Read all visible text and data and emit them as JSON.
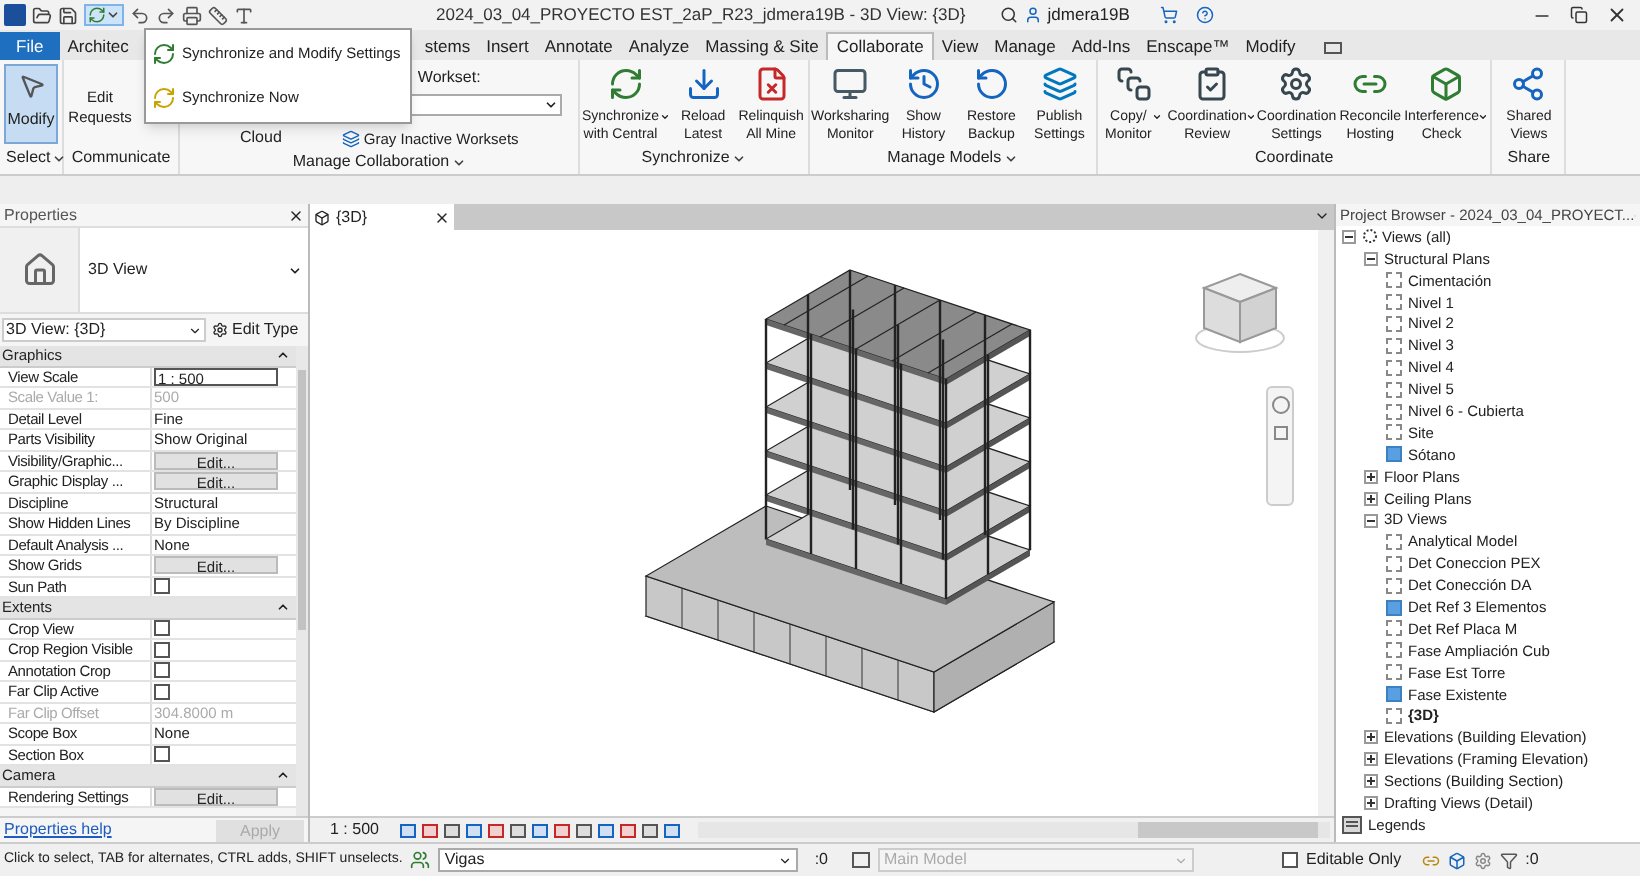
{
  "title_bar": {
    "title": "2024_03_04_PROYECTO EST_2aP_R23_jdmera19B - 3D View: {3D}",
    "user": "jdmera19B"
  },
  "sync_menu": [
    {
      "label": "Synchronize and Modify Settings"
    },
    {
      "label": "Synchronize Now"
    }
  ],
  "tabs": [
    {
      "label": "File",
      "kind": "file",
      "selected": false
    },
    {
      "label": "Architec",
      "kind": "tab",
      "selected": false
    },
    {
      "label": "stems",
      "kind": "tab",
      "selected": false
    },
    {
      "label": "Insert",
      "kind": "tab",
      "selected": false
    },
    {
      "label": "Annotate",
      "kind": "tab",
      "selected": false
    },
    {
      "label": "Analyze",
      "kind": "tab",
      "selected": false
    },
    {
      "label": "Massing & Site",
      "kind": "tab",
      "selected": false
    },
    {
      "label": "Collaborate",
      "kind": "tab",
      "selected": true
    },
    {
      "label": "View",
      "kind": "tab",
      "selected": false
    },
    {
      "label": "Manage",
      "kind": "tab",
      "selected": false
    },
    {
      "label": "Add-Ins",
      "kind": "tab",
      "selected": false
    },
    {
      "label": "Enscape™",
      "kind": "tab",
      "selected": false
    },
    {
      "label": "Modify",
      "kind": "tab",
      "selected": false
    }
  ],
  "ribbon": {
    "select": {
      "button": {
        "label": "Modify",
        "selected": true
      },
      "label": "Select"
    },
    "communicate": {
      "button": {
        "label": "Edit Requests"
      },
      "label": "Communicate"
    },
    "manage_collaboration": {
      "cloud": "Cloud",
      "workset_label": "Workset:",
      "gray_inactive": "Gray Inactive Worksets",
      "label": "Manage Collaboration"
    },
    "panels": [
      {
        "label": "Synchronize",
        "buttons": [
          {
            "label": "Synchronize with Central",
            "split": true
          },
          {
            "label": "Reload Latest",
            "split": false
          },
          {
            "label": "Relinquish All Mine",
            "split": false
          }
        ]
      },
      {
        "label": "Manage Models",
        "buttons": [
          {
            "label": "Worksharing Monitor",
            "split": false
          },
          {
            "label": "Show History",
            "split": false
          },
          {
            "label": "Restore Backup",
            "split": false
          },
          {
            "label": "Publish Settings",
            "split": false
          }
        ]
      },
      {
        "label": "Coordinate",
        "buttons": [
          {
            "label": "Copy/ Monitor",
            "split": true
          },
          {
            "label": "Coordination Review",
            "split": true
          },
          {
            "label": "Coordination Settings",
            "split": false
          },
          {
            "label": "Reconcile Hosting",
            "split": false
          },
          {
            "label": "Interference Check",
            "split": true
          }
        ]
      },
      {
        "label": "Share",
        "buttons": [
          {
            "label": "Shared Views",
            "split": false
          }
        ]
      }
    ]
  },
  "properties": {
    "title": "Properties",
    "type_name": "3D View",
    "instance": "3D View: {3D}",
    "edit_type": "Edit Type",
    "rows": [
      {
        "kind": "group",
        "label": "Graphics"
      },
      {
        "kind": "input",
        "label": "View Scale",
        "value": "1 : 500",
        "disabled": false
      },
      {
        "kind": "text",
        "label": "Scale Value 1:",
        "value": "500",
        "disabled": true
      },
      {
        "kind": "text",
        "label": "Detail Level",
        "value": "Fine",
        "disabled": false
      },
      {
        "kind": "text",
        "label": "Parts Visibility",
        "value": "Show Original",
        "disabled": false
      },
      {
        "kind": "button",
        "label": "Visibility/Graphic...",
        "value": "Edit...",
        "disabled": false
      },
      {
        "kind": "button",
        "label": "Graphic Display ...",
        "value": "Edit...",
        "disabled": false
      },
      {
        "kind": "text",
        "label": "Discipline",
        "value": "Structural",
        "disabled": false
      },
      {
        "kind": "text",
        "label": "Show Hidden Lines",
        "value": "By Discipline",
        "disabled": false
      },
      {
        "kind": "text",
        "label": "Default Analysis ...",
        "value": "None",
        "disabled": false
      },
      {
        "kind": "button",
        "label": "Show Grids",
        "value": "Edit...",
        "disabled": false
      },
      {
        "kind": "checkbox",
        "label": "Sun Path",
        "checked": false,
        "disabled": false
      },
      {
        "kind": "group",
        "label": "Extents"
      },
      {
        "kind": "checkbox",
        "label": "Crop View",
        "checked": false,
        "disabled": false
      },
      {
        "kind": "checkbox",
        "label": "Crop Region Visible",
        "checked": false,
        "disabled": false
      },
      {
        "kind": "checkbox",
        "label": "Annotation Crop",
        "checked": false,
        "disabled": false
      },
      {
        "kind": "checkbox",
        "label": "Far Clip Active",
        "checked": false,
        "disabled": false
      },
      {
        "kind": "text",
        "label": "Far Clip Offset",
        "value": "304.8000 m",
        "disabled": true
      },
      {
        "kind": "text",
        "label": "Scope Box",
        "value": "None",
        "disabled": false
      },
      {
        "kind": "checkbox",
        "label": "Section Box",
        "checked": false,
        "disabled": false
      },
      {
        "kind": "group",
        "label": "Camera"
      },
      {
        "kind": "button",
        "label": "Rendering Settings",
        "value": "Edit...",
        "disabled": false
      }
    ],
    "help": "Properties help",
    "apply": {
      "label": "Apply",
      "disabled": true
    }
  },
  "view_tab": {
    "label": "{3D}"
  },
  "view_bar": {
    "scale": "1 : 500"
  },
  "project_browser": {
    "title": "Project Browser - 2024_03_04_PROYECT...",
    "tree": [
      {
        "kind": "root",
        "label": "Views (all)",
        "expanded": true,
        "children": [
          {
            "kind": "group",
            "label": "Structural Plans",
            "expanded": true,
            "children": [
              {
                "kind": "view",
                "label": "Cimentación",
                "on_sheet": false,
                "active": false
              },
              {
                "kind": "view",
                "label": "Nivel 1",
                "on_sheet": false,
                "active": false
              },
              {
                "kind": "view",
                "label": "Nivel 2",
                "on_sheet": false,
                "active": false
              },
              {
                "kind": "view",
                "label": "Nivel 3",
                "on_sheet": false,
                "active": false
              },
              {
                "kind": "view",
                "label": "Nivel 4",
                "on_sheet": false,
                "active": false
              },
              {
                "kind": "view",
                "label": "Nivel 5",
                "on_sheet": false,
                "active": false
              },
              {
                "kind": "view",
                "label": "Nivel 6 - Cubierta",
                "on_sheet": false,
                "active": false
              },
              {
                "kind": "view",
                "label": "Site",
                "on_sheet": false,
                "active": false
              },
              {
                "kind": "view",
                "label": "Sótano",
                "on_sheet": true,
                "active": false
              }
            ]
          },
          {
            "kind": "group",
            "label": "Floor Plans",
            "expanded": false
          },
          {
            "kind": "group",
            "label": "Ceiling Plans",
            "expanded": false
          },
          {
            "kind": "group",
            "label": "3D Views",
            "expanded": true,
            "children": [
              {
                "kind": "view",
                "label": "Analytical Model",
                "on_sheet": false,
                "active": false
              },
              {
                "kind": "view",
                "label": "Det Coneccion PEX",
                "on_sheet": false,
                "active": false
              },
              {
                "kind": "view",
                "label": "Det Conección DA",
                "on_sheet": false,
                "active": false
              },
              {
                "kind": "view",
                "label": "Det Ref 3 Elementos",
                "on_sheet": true,
                "active": false
              },
              {
                "kind": "view",
                "label": "Det Ref Placa M",
                "on_sheet": false,
                "active": false
              },
              {
                "kind": "view",
                "label": "Fase Ampliación Cub",
                "on_sheet": false,
                "active": false
              },
              {
                "kind": "view",
                "label": "Fase Est Torre",
                "on_sheet": false,
                "active": false
              },
              {
                "kind": "view",
                "label": "Fase Existente",
                "on_sheet": true,
                "active": false
              },
              {
                "kind": "view",
                "label": "{3D}",
                "on_sheet": false,
                "active": true
              }
            ]
          },
          {
            "kind": "group",
            "label": "Elevations (Building Elevation)",
            "expanded": false
          },
          {
            "kind": "group",
            "label": "Elevations (Framing Elevation)",
            "expanded": false
          },
          {
            "kind": "group",
            "label": "Sections (Building Section)",
            "expanded": false
          },
          {
            "kind": "group",
            "label": "Drafting Views (Detail)",
            "expanded": false
          }
        ]
      },
      {
        "kind": "legend",
        "label": "Legends"
      }
    ]
  },
  "status_bar": {
    "message": "Click to select, TAB for alternates, CTRL adds, SHIFT unselects.",
    "workset": "Vigas",
    "selection_count": ":0",
    "design_option": {
      "value": "Main Model",
      "disabled": true
    },
    "editable_only": {
      "label": "Editable Only",
      "checked": false
    },
    "filter_count": ":0"
  }
}
